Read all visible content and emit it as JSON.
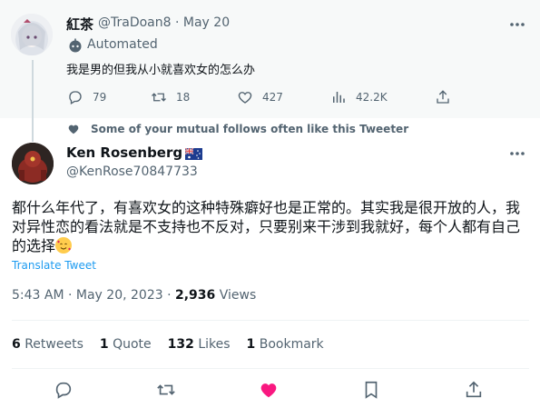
{
  "parent_tweet": {
    "name": "紅茶",
    "handle": "@TraDoan8",
    "date": "· May 20",
    "automated_label": "Automated",
    "text": "我是男的但我从小就喜欢女的怎么办",
    "stats": {
      "replies": "79",
      "retweets": "18",
      "likes": "427",
      "views": "42.2K"
    }
  },
  "social_context": "Some of your mutual follows often like this Tweeter",
  "main_tweet": {
    "name": "Ken Rosenberg",
    "handle": "@KenRose70847733",
    "text": "都什么年代了，有喜欢女的这种特殊癖好也是正常的。其实我是很开放的人，我对异性恋的看法就是不支持也不反对，只要别来干涉到我就好，每个人都有自己的选择",
    "translate": "Translate Tweet",
    "time": "5:43 AM · May 20, 2023 · ",
    "views_count": "2,936",
    "views_label": " Views",
    "counts": {
      "retweets_num": "6",
      "retweets_label": " Retweets",
      "quote_num": "1",
      "quote_label": " Quote",
      "likes_num": "132",
      "likes_label": " Likes",
      "bookmark_num": "1",
      "bookmark_label": " Bookmark"
    }
  },
  "colors": {
    "accent": "#1d9bf0",
    "like_active": "#f91880",
    "muted": "#536471"
  }
}
